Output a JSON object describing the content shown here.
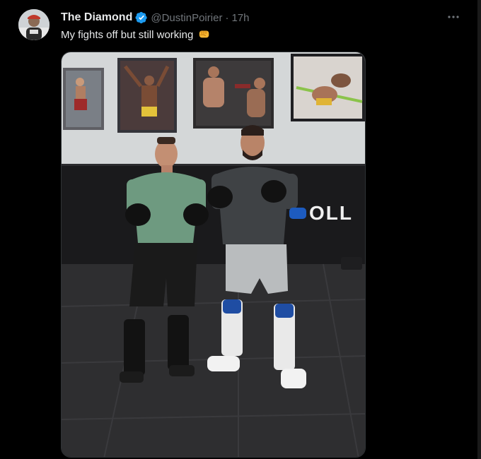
{
  "tweet": {
    "author": {
      "display_name": "The Diamond",
      "handle": "@DustinPoirier",
      "verified": true,
      "avatar_icon": "avatar-photo"
    },
    "separator": "·",
    "time": "17h",
    "text": "My fights off but still working",
    "emoji": "fist-emoji",
    "more_icon": "more-horizontal-icon",
    "media": {
      "type": "photo",
      "wall_text": "OLL"
    }
  },
  "colors": {
    "background": "#000000",
    "text_primary": "#e7e9ea",
    "text_secondary": "#71767b",
    "verified_blue": "#1d9bf0",
    "border": "#2f3336"
  }
}
